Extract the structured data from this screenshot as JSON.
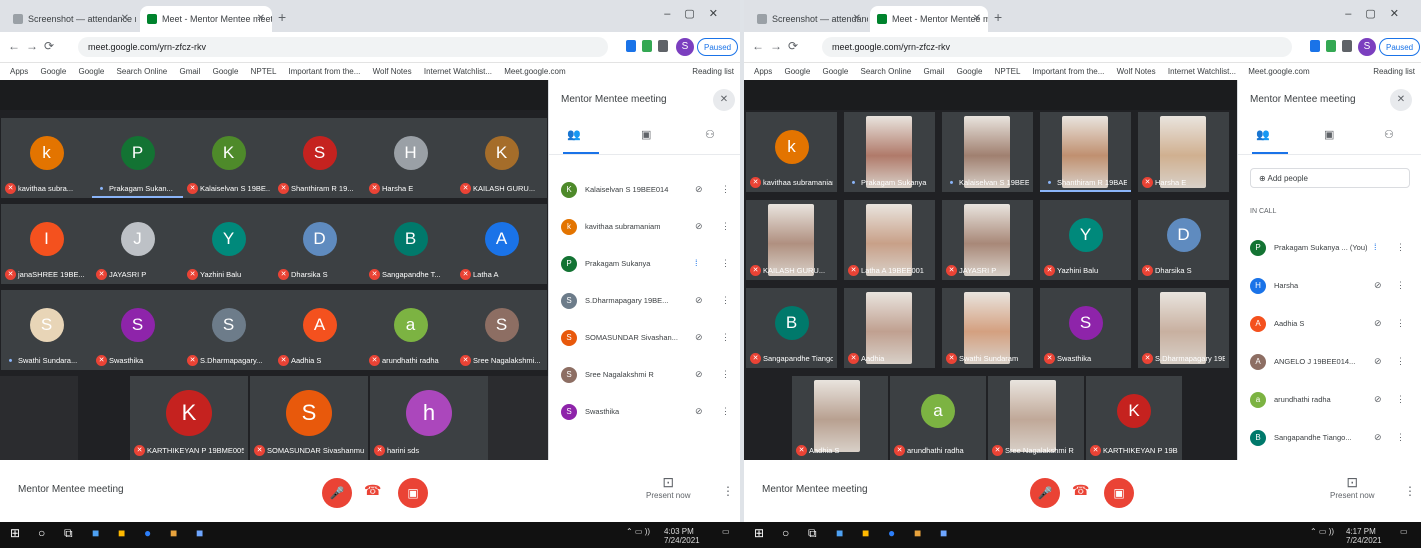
{
  "left": {
    "tabs": [
      {
        "label": "Screenshot — attendance record",
        "active": false
      },
      {
        "label": "Meet - Mentor Mentee meeting",
        "active": true
      }
    ],
    "url": "meet.google.com/yrn-zfcz-rkv",
    "pause_label": "Paused",
    "profile_initial": "S",
    "bookmarks": [
      "Apps",
      "Google",
      "Google",
      "Search Online",
      "Gmail",
      "Google",
      "NPTEL",
      "Important from the...",
      "Wolf Notes",
      "Internet Watchlist...",
      "Meet.google.com"
    ],
    "reading_list": "Reading list",
    "meeting_title": "Mentor Mentee meeting",
    "tiles": [
      {
        "name": "kavithaa subra...",
        "initial": "k",
        "color": "#e37400",
        "mic": "muted"
      },
      {
        "name": "Prakagam Sukan...",
        "initial": "P",
        "color": "#137333",
        "mic": "on",
        "speaking": true
      },
      {
        "name": "Kalaiselvan S 19BE...",
        "initial": "K",
        "color": "#4e8a2a",
        "mic": "muted"
      },
      {
        "name": "Shanthiram R 19...",
        "initial": "S",
        "color": "#c5221f",
        "mic": "muted"
      },
      {
        "name": "Harsha E",
        "initial": "H",
        "color": "#9aa0a6",
        "mic": "muted"
      },
      {
        "name": "KAILASH GURU...",
        "initial": "K",
        "color": "#a56d2a",
        "mic": "muted"
      },
      {
        "name": "janaSHREE 19BE...",
        "initial": "I",
        "color": "#f4511e",
        "mic": "muted"
      },
      {
        "name": "JAYASRI P",
        "initial": "J",
        "color": "#bdc1c6",
        "mic": "muted"
      },
      {
        "name": "Yazhini Balu",
        "initial": "Y",
        "color": "#00897b",
        "mic": "muted"
      },
      {
        "name": "Dharsika S",
        "initial": "D",
        "color": "#5f8bbf",
        "mic": "muted"
      },
      {
        "name": "Sangapandhe T...",
        "initial": "B",
        "color": "#00796b",
        "mic": "muted"
      },
      {
        "name": "Latha A",
        "initial": "A",
        "color": "#1a73e8",
        "mic": "muted"
      },
      {
        "name": "Swathi Sundara...",
        "initial": "S",
        "color": "#e8d5b7",
        "mic": "on"
      },
      {
        "name": "Swasthika",
        "initial": "S",
        "color": "#8e24aa",
        "mic": "muted"
      },
      {
        "name": "S.Dharmapagary...",
        "initial": "S",
        "color": "#6d7c8a",
        "mic": "muted"
      },
      {
        "name": "Aadhia S",
        "initial": "A",
        "color": "#f4511e",
        "mic": "muted"
      },
      {
        "name": "arundhathi radha",
        "initial": "a",
        "color": "#7cb342",
        "mic": "muted"
      },
      {
        "name": "Sree Nagalakshmi...",
        "initial": "S",
        "color": "#8d6e63",
        "mic": "muted"
      }
    ],
    "tiles_bottom": [
      {
        "name": "KARTHIKEYAN P 19BME005",
        "initial": "K",
        "color": "#c5221f",
        "mic": "muted"
      },
      {
        "name": "SOMASUNDAR Sivashanmu",
        "initial": "S",
        "color": "#e8590c",
        "mic": "muted"
      },
      {
        "name": "harini sds",
        "initial": "h",
        "color": "#ab47bc",
        "mic": "muted"
      }
    ],
    "people_title": "Mentor Mentee meeting",
    "people": [
      {
        "name": "Kalaiselvan S 19BEE014",
        "initial": "K",
        "color": "#4e8a2a",
        "mic": "muted"
      },
      {
        "name": "kavithaa subramaniam",
        "initial": "k",
        "color": "#e37400",
        "mic": "muted"
      },
      {
        "name": "Prakagam Sukanya",
        "initial": "P",
        "color": "#137333",
        "mic": "on"
      },
      {
        "name": "S.Dharmapagary 19BE...",
        "initial": "S",
        "color": "#6d7c8a",
        "mic": "muted"
      },
      {
        "name": "SOMASUNDAR Sivashan...",
        "initial": "S",
        "color": "#e8590c",
        "mic": "muted"
      },
      {
        "name": "Sree Nagalakshmi R",
        "initial": "S",
        "color": "#8d6e63",
        "mic": "muted"
      },
      {
        "name": "Swasthika",
        "initial": "S",
        "color": "#8e24aa",
        "mic": "muted"
      }
    ],
    "present_label": "Present now"
  },
  "right": {
    "tabs": [
      {
        "label": "Screenshot — attendance record",
        "active": false
      },
      {
        "label": "Meet - Mentor Mentee meeting",
        "active": true
      }
    ],
    "url": "meet.google.com/yrn-zfcz-rkv",
    "pause_label": "Paused",
    "profile_initial": "S",
    "bookmarks": [
      "Apps",
      "Google",
      "Google",
      "Search Online",
      "Gmail",
      "Google",
      "NPTEL",
      "Important from the...",
      "Wolf Notes",
      "Internet Watchlist...",
      "Meet.google.com"
    ],
    "reading_list": "Reading list",
    "meeting_title": "Mentor Mentee meeting",
    "tiles": [
      {
        "name": "kavithaa subramaniam",
        "initial": "k",
        "color": "#e37400",
        "mic": "muted",
        "type": "avatar"
      },
      {
        "name": "Prakagam Sukanya",
        "initial": "P",
        "color": "#b07a6a",
        "mic": "on",
        "type": "camera"
      },
      {
        "name": "Kalaiselvan S 19BEE014",
        "initial": "K",
        "color": "#a08070",
        "mic": "on",
        "type": "camera"
      },
      {
        "name": "Shanthiram R 19BAE...",
        "initial": "S",
        "color": "#c09070",
        "mic": "on",
        "type": "camera",
        "speaking": true
      },
      {
        "name": "Harsha E",
        "initial": "H",
        "color": "#d0b090",
        "mic": "muted",
        "type": "camera"
      },
      {
        "name": "KAILASH GURU...",
        "initial": "K",
        "color": "#b09080",
        "mic": "muted",
        "type": "camera"
      },
      {
        "name": "Latha A 19BEE001",
        "initial": "L",
        "color": "#c8a088",
        "mic": "muted",
        "type": "camera"
      },
      {
        "name": "JAYASRI P",
        "initial": "J",
        "color": "#a88878",
        "mic": "muted",
        "type": "camera"
      },
      {
        "name": "Yazhini Balu",
        "initial": "Y",
        "color": "#00897b",
        "mic": "muted",
        "type": "avatar"
      },
      {
        "name": "Dharsika S",
        "initial": "D",
        "color": "#5f8bbf",
        "mic": "muted",
        "type": "avatar"
      },
      {
        "name": "Sangapandhe Tiango...",
        "initial": "B",
        "color": "#00796b",
        "mic": "muted",
        "type": "avatar"
      },
      {
        "name": "Aadhia",
        "initial": "A",
        "color": "#c0a090",
        "mic": "muted",
        "type": "camera"
      },
      {
        "name": "Swathi Sundaram",
        "initial": "S",
        "color": "#d4a080",
        "mic": "muted",
        "type": "camera"
      },
      {
        "name": "Swasthika",
        "initial": "S",
        "color": "#8e24aa",
        "mic": "muted",
        "type": "avatar"
      },
      {
        "name": "S.Dharmapagary 19BE...",
        "initial": "S",
        "color": "#c8b0a0",
        "mic": "muted",
        "type": "camera"
      }
    ],
    "tiles_bottom": [
      {
        "name": "Aadhia S",
        "initial": "A",
        "color": "#b8a090",
        "mic": "muted",
        "type": "camera"
      },
      {
        "name": "arundhathi radha",
        "initial": "a",
        "color": "#7cb342",
        "mic": "muted",
        "type": "avatar"
      },
      {
        "name": "Sree Nagalakshmi R",
        "initial": "S",
        "color": "#c0a898",
        "mic": "muted",
        "type": "camera"
      },
      {
        "name": "KARTHIKEYAN P 19BME...",
        "initial": "K",
        "color": "#c5221f",
        "mic": "muted",
        "type": "avatar"
      }
    ],
    "people_title": "Mentor Mentee meeting",
    "add_people": "Add people",
    "in_call": "IN CALL",
    "people": [
      {
        "name": "Prakagam Sukanya ... (You)",
        "initial": "P",
        "color": "#137333",
        "mic": "on"
      },
      {
        "name": "Harsha",
        "initial": "H",
        "color": "#1a73e8",
        "mic": "muted"
      },
      {
        "name": "Aadhia S",
        "initial": "A",
        "color": "#f4511e",
        "mic": "muted"
      },
      {
        "name": "ANGELO J 19BEE014...",
        "initial": "A",
        "color": "#8d6e63",
        "mic": "muted"
      },
      {
        "name": "arundhathi radha",
        "initial": "a",
        "color": "#7cb342",
        "mic": "muted"
      },
      {
        "name": "Sangapandhe Tiango...",
        "initial": "B",
        "color": "#00796b",
        "mic": "muted"
      }
    ],
    "present_label": "Present now"
  },
  "taskbar": {
    "left_time": "4:03 PM",
    "left_date": "7/24/2021",
    "right_time": "4:17 PM",
    "right_date": "7/24/2021"
  }
}
